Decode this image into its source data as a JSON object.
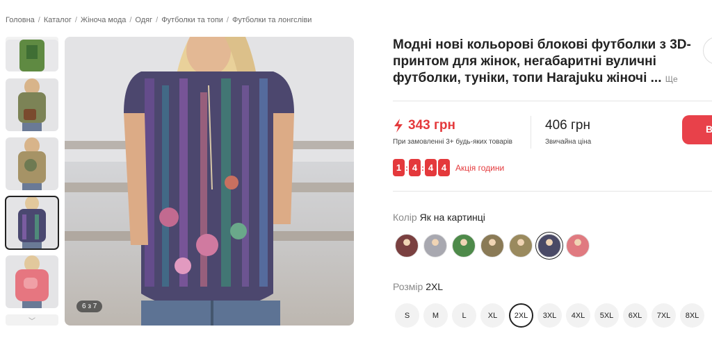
{
  "breadcrumb": [
    "Головна",
    "Каталог",
    "Жіноча мода",
    "Одяг",
    "Футболки та топи",
    "Футболки та лонгсліви"
  ],
  "gallery": {
    "counter": "6 з 7",
    "thumb_colors": [
      "#6b8a4a",
      "#7a8058",
      "#9a8a66",
      "#4a4a6e",
      "#e0707a"
    ]
  },
  "product": {
    "title": "Модні нові кольорові блокові футболки з 3D-принтом для жінок, негабаритні вуличні футболки, туніки, топи Harajuku жіночі ...",
    "more": "Ще"
  },
  "price": {
    "sale": "343 грн",
    "sale_note": "При замовленні 3+ будь-яких товарів",
    "regular": "406 грн",
    "regular_note": "Звичайна ціна"
  },
  "buy_label": "В",
  "timer": {
    "digits": [
      "1",
      "4",
      "4",
      "4"
    ],
    "label": "Акція години"
  },
  "color": {
    "label": "Колір",
    "selected": "Як на картинці",
    "swatches": [
      "#7a4040",
      "#a8a8b0",
      "#4e8a4a",
      "#8a7a56",
      "#9a8a5e",
      "#4a4a66",
      "#e07a80"
    ],
    "active_index": 5
  },
  "size": {
    "label": "Розмір",
    "selected": "2XL",
    "options": [
      "S",
      "M",
      "L",
      "XL",
      "2XL",
      "3XL",
      "4XL",
      "5XL",
      "6XL",
      "7XL",
      "8XL"
    ],
    "active_index": 4
  }
}
